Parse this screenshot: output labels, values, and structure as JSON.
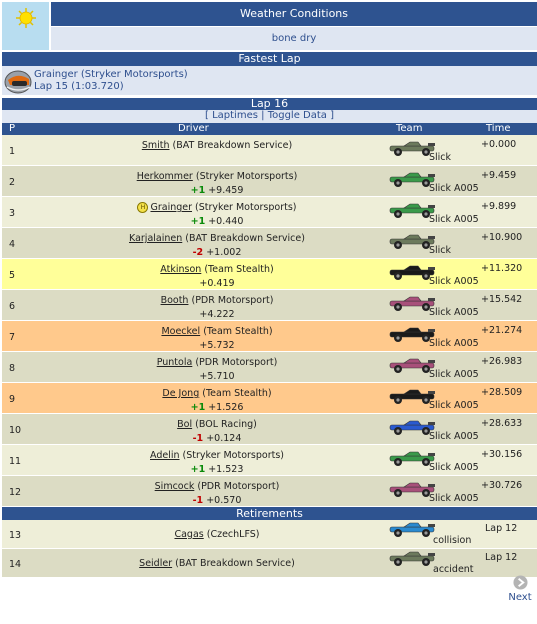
{
  "weather": {
    "title": "Weather Conditions",
    "value": "bone dry",
    "icon": "sun-icon"
  },
  "fastest_lap": {
    "title": "Fastest Lap",
    "driver": "Grainger (Stryker Motorsports)",
    "lap": "Lap 15 (1:03.720)",
    "icon": "helmet-icon"
  },
  "lap": {
    "title": "Lap 16",
    "link_laptimes": "Laptimes",
    "link_toggle": "Toggle Data",
    "bracket_open": "[",
    "separator": "|",
    "bracket_close": "]"
  },
  "columns": {
    "p": "P",
    "driver": "Driver",
    "team": "Team",
    "time": "Time"
  },
  "colors": {
    "header_blue": "#2e5390",
    "row_light": "#eeeed8",
    "row_dark": "#dcdcc4",
    "highlight_yellow": "#ffff99",
    "highlight_orange": "#ffc98c",
    "gain_green": "#0a8a0a",
    "loss_red": "#c00000"
  },
  "results": [
    {
      "pos": "1",
      "name": "Smith",
      "team": "(BAT Breakdown Service)",
      "change": "",
      "delta": "",
      "tyre": "Slick",
      "gap": "+0.000",
      "highlight": "light",
      "car_color": "#6c7a5c",
      "pit": ""
    },
    {
      "pos": "2",
      "name": "Herkommer",
      "team": "(Stryker Motorsports)",
      "change": "+1",
      "delta": "+9.459",
      "tyre": "Slick A005",
      "gap": "+9.459",
      "highlight": "dark",
      "car_color": "#3a9a4a",
      "pit": ""
    },
    {
      "pos": "3",
      "name": "Grainger",
      "team": "(Stryker Motorsports)",
      "change": "+1",
      "delta": "+0.440",
      "tyre": "Slick A005",
      "gap": "+9.899",
      "highlight": "light",
      "car_color": "#3a9a4a",
      "pit": "H"
    },
    {
      "pos": "4",
      "name": "Karjalainen",
      "team": "(BAT Breakdown Service)",
      "change": "-2",
      "delta": "+1.002",
      "tyre": "Slick",
      "gap": "+10.900",
      "highlight": "dark",
      "car_color": "#6c7a5c",
      "pit": ""
    },
    {
      "pos": "5",
      "name": "Atkinson",
      "team": "(Team Stealth)",
      "change": "",
      "delta": "+0.419",
      "tyre": "Slick A005",
      "gap": "+11.320",
      "highlight": "yellow",
      "car_color": "#1a1a1a",
      "pit": ""
    },
    {
      "pos": "6",
      "name": "Booth",
      "team": "(PDR Motorsport)",
      "change": "",
      "delta": "+4.222",
      "tyre": "Slick A005",
      "gap": "+15.542",
      "highlight": "dark",
      "car_color": "#a8507a",
      "pit": ""
    },
    {
      "pos": "7",
      "name": "Moeckel",
      "team": "(Team Stealth)",
      "change": "",
      "delta": "+5.732",
      "tyre": "Slick A005",
      "gap": "+21.274",
      "highlight": "orange",
      "car_color": "#1a1a1a",
      "pit": ""
    },
    {
      "pos": "8",
      "name": "Puntola",
      "team": "(PDR Motorsport)",
      "change": "",
      "delta": "+5.710",
      "tyre": "Slick A005",
      "gap": "+26.983",
      "highlight": "dark",
      "car_color": "#a8507a",
      "pit": ""
    },
    {
      "pos": "9",
      "name": "De Jong",
      "team": "(Team Stealth)",
      "change": "+1",
      "delta": "+1.526",
      "tyre": "Slick A005",
      "gap": "+28.509",
      "highlight": "orange",
      "car_color": "#1a1a1a",
      "pit": ""
    },
    {
      "pos": "10",
      "name": "Bol",
      "team": "(BOL Racing)",
      "change": "-1",
      "delta": "+0.124",
      "tyre": "Slick A005",
      "gap": "+28.633",
      "highlight": "dark",
      "car_color": "#2a5ad0",
      "pit": ""
    },
    {
      "pos": "11",
      "name": "Adelin",
      "team": "(Stryker Motorsports)",
      "change": "+1",
      "delta": "+1.523",
      "tyre": "Slick A005",
      "gap": "+30.156",
      "highlight": "light",
      "car_color": "#3a9a4a",
      "pit": ""
    },
    {
      "pos": "12",
      "name": "Simcock",
      "team": "(PDR Motorsport)",
      "change": "-1",
      "delta": "+0.570",
      "tyre": "Slick A005",
      "gap": "+30.726",
      "highlight": "dark",
      "car_color": "#a8507a",
      "pit": ""
    }
  ],
  "retirements": {
    "title": "Retirements",
    "rows": [
      {
        "pos": "13",
        "name": "Cagas",
        "team": "(CzechLFS)",
        "reason": "collision",
        "lap": "Lap 12",
        "highlight": "light",
        "car_color": "#2a8ad0"
      },
      {
        "pos": "14",
        "name": "Seidler",
        "team": "(BAT Breakdown Service)",
        "reason": "accident",
        "lap": "Lap 12",
        "highlight": "dark",
        "car_color": "#6c7a5c"
      }
    ]
  },
  "nav": {
    "next_label": "Next",
    "icon": "next-arrow-icon"
  }
}
